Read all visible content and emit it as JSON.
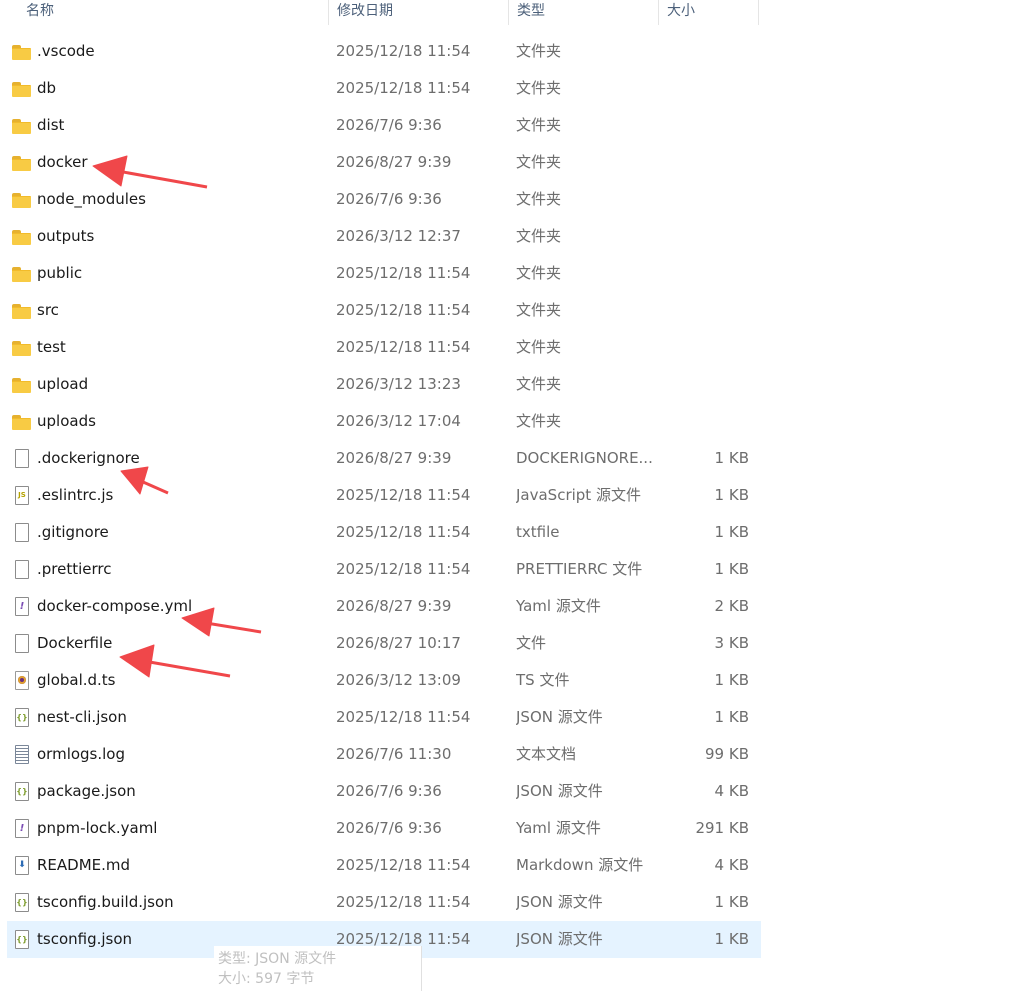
{
  "columns": {
    "name": "名称",
    "date": "修改日期",
    "type": "类型",
    "size": "大小"
  },
  "files": [
    {
      "name": ".vscode",
      "date": "2025/12/18 11:54",
      "type": "文件夹",
      "size": "",
      "icon": "folder-icon"
    },
    {
      "name": "db",
      "date": "2025/12/18 11:54",
      "type": "文件夹",
      "size": "",
      "icon": "folder-icon"
    },
    {
      "name": "dist",
      "date": "2026/7/6 9:36",
      "type": "文件夹",
      "size": "",
      "icon": "folder-icon"
    },
    {
      "name": "docker",
      "date": "2026/8/27 9:39",
      "type": "文件夹",
      "size": "",
      "icon": "folder-icon"
    },
    {
      "name": "node_modules",
      "date": "2026/7/6 9:36",
      "type": "文件夹",
      "size": "",
      "icon": "folder-icon"
    },
    {
      "name": "outputs",
      "date": "2026/3/12 12:37",
      "type": "文件夹",
      "size": "",
      "icon": "folder-icon"
    },
    {
      "name": "public",
      "date": "2025/12/18 11:54",
      "type": "文件夹",
      "size": "",
      "icon": "folder-icon"
    },
    {
      "name": "src",
      "date": "2025/12/18 11:54",
      "type": "文件夹",
      "size": "",
      "icon": "folder-icon"
    },
    {
      "name": "test",
      "date": "2025/12/18 11:54",
      "type": "文件夹",
      "size": "",
      "icon": "folder-icon"
    },
    {
      "name": "upload",
      "date": "2026/3/12 13:23",
      "type": "文件夹",
      "size": "",
      "icon": "folder-icon"
    },
    {
      "name": "uploads",
      "date": "2026/3/12 17:04",
      "type": "文件夹",
      "size": "",
      "icon": "folder-icon"
    },
    {
      "name": ".dockerignore",
      "date": "2026/8/27 9:39",
      "type": "DOCKERIGNORE...",
      "size": "1 KB",
      "icon": "file-icon"
    },
    {
      "name": ".eslintrc.js",
      "date": "2025/12/18 11:54",
      "type": "JavaScript 源文件",
      "size": "1 KB",
      "icon": "js-file-icon"
    },
    {
      "name": ".gitignore",
      "date": "2025/12/18 11:54",
      "type": "txtfile",
      "size": "1 KB",
      "icon": "file-icon"
    },
    {
      "name": ".prettierrc",
      "date": "2025/12/18 11:54",
      "type": "PRETTIERRC 文件",
      "size": "1 KB",
      "icon": "file-icon"
    },
    {
      "name": "docker-compose.yml",
      "date": "2026/8/27 9:39",
      "type": "Yaml 源文件",
      "size": "2 KB",
      "icon": "yaml-file-icon"
    },
    {
      "name": "Dockerfile",
      "date": "2026/8/27 10:17",
      "type": "文件",
      "size": "3 KB",
      "icon": "file-icon"
    },
    {
      "name": "global.d.ts",
      "date": "2026/3/12 13:09",
      "type": "TS 文件",
      "size": "1 KB",
      "icon": "ts-file-icon"
    },
    {
      "name": "nest-cli.json",
      "date": "2025/12/18 11:54",
      "type": "JSON 源文件",
      "size": "1 KB",
      "icon": "json-file-icon"
    },
    {
      "name": "ormlogs.log",
      "date": "2026/7/6 11:30",
      "type": "文本文档",
      "size": "99 KB",
      "icon": "log-file-icon"
    },
    {
      "name": "package.json",
      "date": "2026/7/6 9:36",
      "type": "JSON 源文件",
      "size": "4 KB",
      "icon": "json-file-icon"
    },
    {
      "name": "pnpm-lock.yaml",
      "date": "2026/7/6 9:36",
      "type": "Yaml 源文件",
      "size": "291 KB",
      "icon": "yaml-file-icon"
    },
    {
      "name": "README.md",
      "date": "2025/12/18 11:54",
      "type": "Markdown 源文件",
      "size": "4 KB",
      "icon": "markdown-file-icon"
    },
    {
      "name": "tsconfig.build.json",
      "date": "2025/12/18 11:54",
      "type": "JSON 源文件",
      "size": "1 KB",
      "icon": "json-file-icon"
    },
    {
      "name": "tsconfig.json",
      "date": "2025/12/18 11:54",
      "type": "JSON 源文件",
      "size": "1 KB",
      "icon": "json-file-icon",
      "selected": true
    }
  ],
  "tooltip": {
    "type_line": "类型: JSON 源文件",
    "size_line": "大小: 597 字节"
  },
  "colors": {
    "folder": "#f8cb44",
    "selection": "#e5f3ff",
    "annotation_arrow": "#f0474a"
  }
}
